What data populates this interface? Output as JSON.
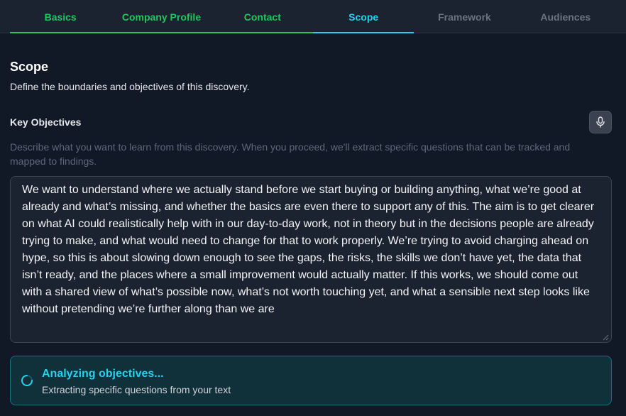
{
  "tabs": [
    {
      "label": "Basics",
      "state": "done"
    },
    {
      "label": "Company Profile",
      "state": "done"
    },
    {
      "label": "Contact",
      "state": "done"
    },
    {
      "label": "Scope",
      "state": "active"
    },
    {
      "label": "Framework",
      "state": "pending"
    },
    {
      "label": "Audiences",
      "state": "pending"
    }
  ],
  "section": {
    "title": "Scope",
    "subtitle": "Define the boundaries and objectives of this discovery."
  },
  "objectives": {
    "label": "Key Objectives",
    "mic_icon": "microphone-icon",
    "help_text": "Describe what you want to learn from this discovery. When you proceed, we'll extract specific questions that can be tracked and mapped to findings.",
    "value": "We want to understand where we actually stand before we start buying or building anything, what we’re good at already and what’s missing, and whether the basics are even there to support any of this. The aim is to get clearer on what AI could realistically help with in our day-to-day work, not in theory but in the decisions people are already trying to make, and what would need to change for that to work properly. We’re trying to avoid charging ahead on hype, so this is about slowing down enough to see the gaps, the risks, the skills we don’t have yet, the data that isn’t ready, and the places where a small improvement would actually matter. If this works, we should come out with a shared view of what’s possible now, what’s not worth touching yet, and what a sensible next step looks like without pretending we’re further along than we are"
  },
  "status": {
    "title": "Analyzing objectives...",
    "subtitle": "Extracting specific questions from your text",
    "icon": "spinner-icon"
  },
  "colors": {
    "done": "#22c55e",
    "active": "#22d3ee",
    "pending": "#6b7280",
    "background": "#111826"
  }
}
